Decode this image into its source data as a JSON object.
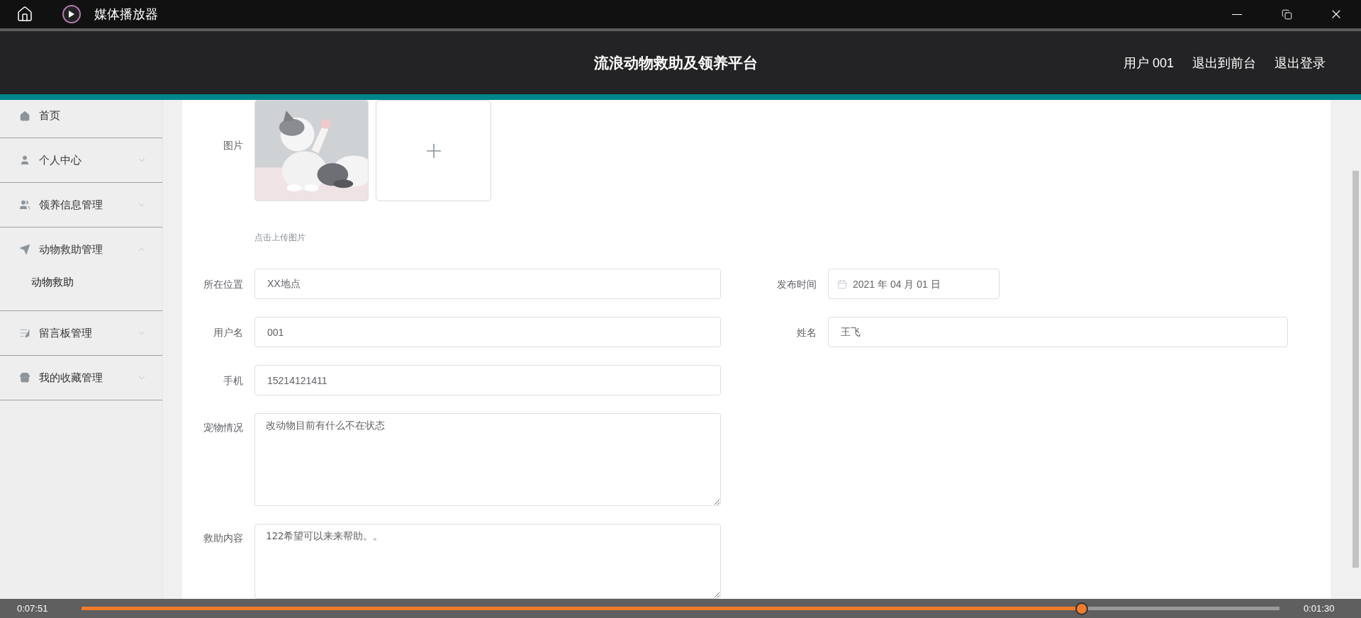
{
  "window": {
    "title": "媒体播放器"
  },
  "header": {
    "title": "流浪动物救助及领养平台",
    "links": [
      "用户 001",
      "退出到前台",
      "退出登录"
    ]
  },
  "sidebar": {
    "items": [
      {
        "label": "首页",
        "kind": "link"
      },
      {
        "label": "个人中心",
        "kind": "menu",
        "expanded": false
      },
      {
        "label": "领养信息管理",
        "kind": "menu",
        "expanded": false
      },
      {
        "label": "动物救助管理",
        "kind": "menu",
        "expanded": true,
        "children": [
          {
            "label": "动物救助"
          }
        ]
      },
      {
        "label": "留言板管理",
        "kind": "menu",
        "expanded": false
      },
      {
        "label": "我的收藏管理",
        "kind": "menu",
        "expanded": false
      }
    ]
  },
  "form": {
    "picture": {
      "label": "图片",
      "hint": "点击上传图片"
    },
    "rows": [
      {
        "fields": [
          {
            "label": "所在位置",
            "value": "XX地点",
            "kind": "text"
          },
          {
            "label": "发布时间",
            "value": "2021 年 04 月 01 日",
            "kind": "date"
          }
        ]
      },
      {
        "fields": [
          {
            "label": "用户名",
            "value": "001",
            "kind": "text"
          },
          {
            "label": "姓名",
            "value": "王飞",
            "kind": "text"
          }
        ]
      },
      {
        "fields": [
          {
            "label": "手机",
            "value": "15214121411",
            "kind": "text"
          }
        ]
      },
      {
        "fields": [
          {
            "label": "宠物情况",
            "value": "改动物目前有什么不在状态",
            "kind": "textarea"
          }
        ]
      },
      {
        "fields": [
          {
            "label": "救助内容",
            "value": "122希望可以来来帮助。。",
            "kind": "textarea"
          }
        ]
      }
    ]
  },
  "player": {
    "elapsed": "0:07:51",
    "remaining": "0:01:30",
    "level": 0.835
  }
}
